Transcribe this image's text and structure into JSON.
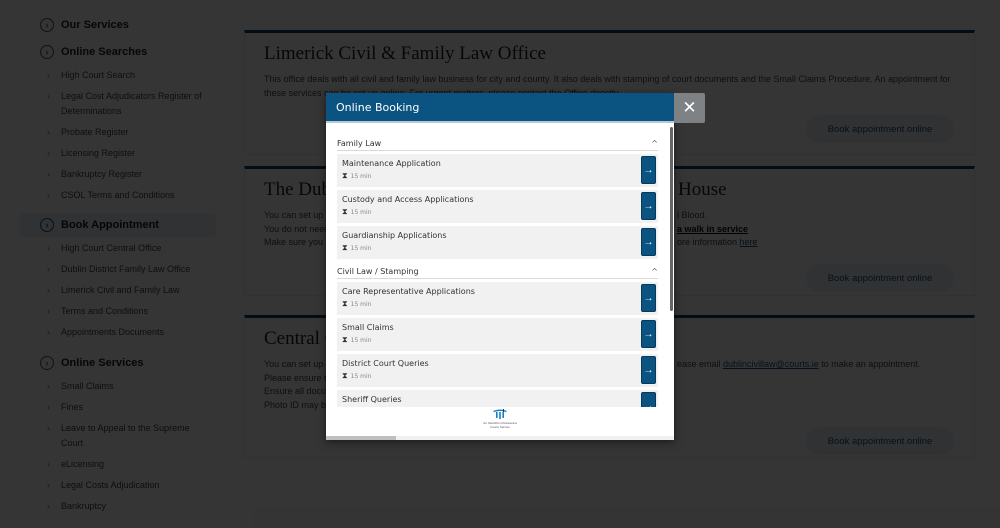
{
  "sidebar": {
    "sections": [
      {
        "label": "Our Services",
        "items": []
      },
      {
        "label": "Online Searches",
        "items": [
          "High Court Search",
          "Legal Cost Adjudicators Register of Determinations",
          "Probate Register",
          "Licensing Register",
          "Bankruptcy Register",
          "CSOL Terms and Conditions"
        ]
      },
      {
        "label": "Book Appointment",
        "active": true,
        "items": [
          "High Court Central Office",
          "Dublin District Family Law Office",
          "Limerick Civil and Family Law",
          "Terms and Conditions",
          "Appointments Documents"
        ]
      },
      {
        "label": "Online Services",
        "items": [
          "Small Claims",
          "Fines",
          "Leave to Appeal to the Supreme Court",
          "eLicensing",
          "Legal Costs Adjudication",
          "Bankruptcy"
        ]
      }
    ]
  },
  "cards": [
    {
      "title": "Limerick Civil & Family Law Office",
      "lines": [
        "This office deals with all civil and family law business for city and county. It also deals with stamping of court documents and the Small Claims Procedure. An appointment for these services can be set up online. For urgent matters, please contact the Office directly."
      ],
      "button": "Book appointment online"
    },
    {
      "title": "The Dub",
      "title_right": "House",
      "lines_left": [
        "You can set up a",
        "You do not need",
        "Make sure you r"
      ],
      "lines_right": [
        "l Blood.",
        "a walk in service",
        "ore information"
      ],
      "link": "here",
      "button": "Book appointment online"
    },
    {
      "title": "Central C",
      "lines_left": [
        "You can set up a",
        "Please ensure t",
        "Ensure all docu",
        "Photo ID may be"
      ],
      "line_right_prefix": "ease email ",
      "email": "dublincivillaw@courts.ie",
      "line_right_suffix": " to make an appointment.",
      "button": "Book appointment online"
    }
  ],
  "modal": {
    "title": "Online Booking",
    "close_label": "✕",
    "groups": [
      {
        "name": "Family Law",
        "services": [
          {
            "name": "Maintenance Application",
            "duration": "15 min"
          },
          {
            "name": "Custody and Access Applications",
            "duration": "15 min"
          },
          {
            "name": "Guardianship Applications",
            "duration": "15 min"
          }
        ]
      },
      {
        "name": "Civil Law / Stamping",
        "services": [
          {
            "name": "Care Representative Applications",
            "duration": "15 min"
          },
          {
            "name": "Small Claims",
            "duration": "15 min"
          },
          {
            "name": "District Court Queries",
            "duration": "15 min"
          },
          {
            "name": "Sheriff Queries",
            "duration": ""
          }
        ]
      }
    ],
    "footer_logo_text": [
      "An tSeirbhís Chúirteanna",
      "Courts Service"
    ]
  },
  "icons": {
    "collapse": "^",
    "arrow": "→",
    "hourglass": "⧗",
    "chevron": "›"
  }
}
